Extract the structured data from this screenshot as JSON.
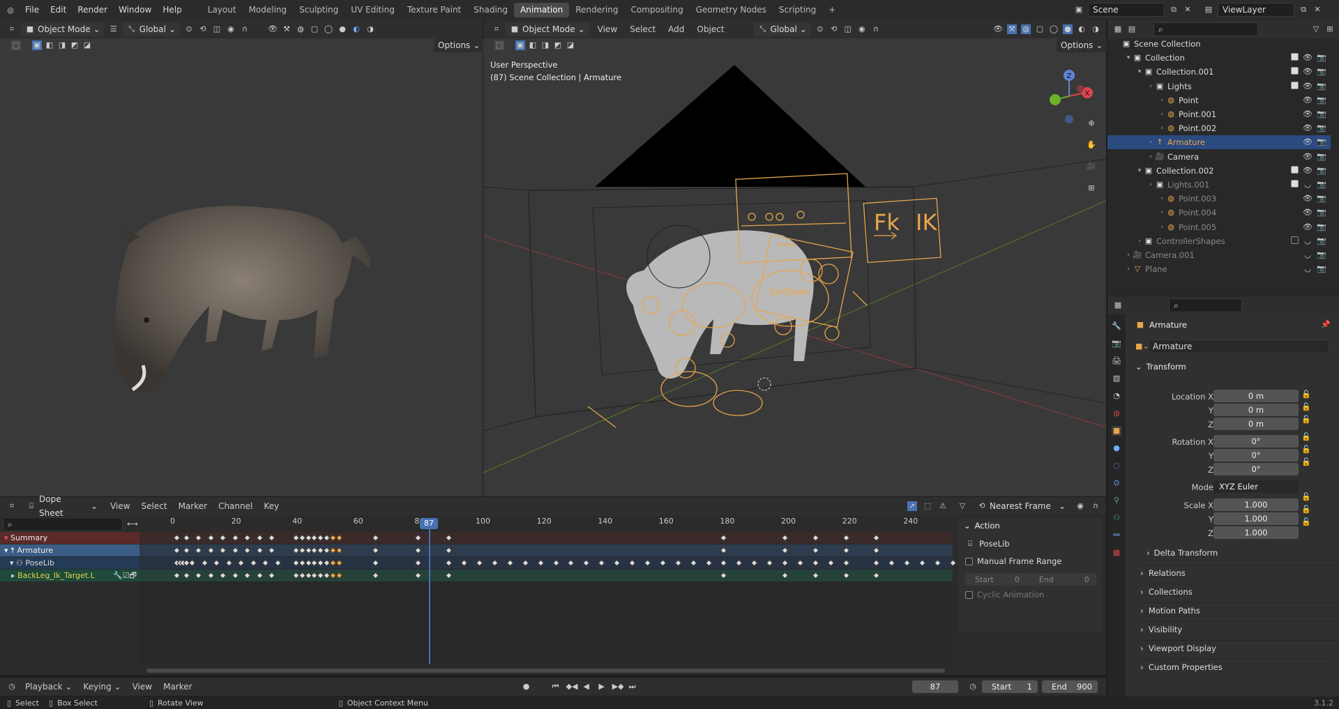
{
  "app": {
    "version": "3.1.2"
  },
  "topbar": {
    "menus": [
      "File",
      "Edit",
      "Render",
      "Window",
      "Help"
    ],
    "workspaces": [
      "Layout",
      "Modeling",
      "Sculpting",
      "UV Editing",
      "Texture Paint",
      "Shading",
      "Animation",
      "Rendering",
      "Compositing",
      "Geometry Nodes",
      "Scripting"
    ],
    "active_workspace": "Animation",
    "add": "+",
    "scene": "Scene",
    "view_layer": "ViewLayer"
  },
  "left_viewport": {
    "mode": "Object Mode",
    "orientation": "Global",
    "options": "Options"
  },
  "main_viewport": {
    "mode": "Object Mode",
    "menus": [
      "View",
      "Select",
      "Add",
      "Object"
    ],
    "orientation": "Global",
    "options": "Options",
    "perspective": "User Perspective",
    "context": "(87) Scene Collection | Armature",
    "fk_label": "Fk",
    "ik_label": "IK",
    "board_text_1": "smile",
    "board_text_2": "EarDown",
    "gizmo": {
      "x": "X",
      "y": "Y",
      "z": "Z"
    }
  },
  "outliner": {
    "search_placeholder": "",
    "rows": [
      {
        "label": "Scene Collection",
        "depth": 0,
        "icon": "collection"
      },
      {
        "label": "Collection",
        "depth": 1,
        "icon": "collection"
      },
      {
        "label": "Collection.001",
        "depth": 2,
        "icon": "collection"
      },
      {
        "label": "Lights",
        "depth": 3,
        "icon": "collection"
      },
      {
        "label": "Point",
        "depth": 4,
        "icon": "light"
      },
      {
        "label": "Point.001",
        "depth": 4,
        "icon": "light"
      },
      {
        "label": "Point.002",
        "depth": 4,
        "icon": "light"
      },
      {
        "label": "Armature",
        "depth": 3,
        "icon": "armature",
        "selected": true
      },
      {
        "label": "Camera",
        "depth": 3,
        "icon": "camera"
      },
      {
        "label": "Collection.002",
        "depth": 2,
        "icon": "collection"
      },
      {
        "label": "Lights.001",
        "depth": 3,
        "icon": "collection",
        "dim": true
      },
      {
        "label": "Point.003",
        "depth": 4,
        "icon": "light",
        "dim": true
      },
      {
        "label": "Point.004",
        "depth": 4,
        "icon": "light",
        "dim": true
      },
      {
        "label": "Point.005",
        "depth": 4,
        "icon": "light",
        "dim": true
      },
      {
        "label": "ControllerShapes",
        "depth": 2,
        "icon": "collection",
        "dim": true
      },
      {
        "label": "Camera.001",
        "depth": 1,
        "icon": "camera",
        "dim": true
      },
      {
        "label": "Plane",
        "depth": 1,
        "icon": "mesh",
        "dim": true
      }
    ]
  },
  "properties": {
    "title": "Armature",
    "object_name": "Armature",
    "transform": "Transform",
    "location_label": "Location X",
    "rotation_label": "Rotation X",
    "scale_label": "Scale X",
    "y": "Y",
    "z": "Z",
    "location": [
      "0 m",
      "0 m",
      "0 m"
    ],
    "rotation": [
      "0°",
      "0°",
      "0°"
    ],
    "mode_label": "Mode",
    "mode_value": "XYZ Euler",
    "scale": [
      "1.000",
      "1.000",
      "1.000"
    ],
    "delta": "Delta Transform",
    "sections": [
      "Relations",
      "Collections",
      "Motion Paths",
      "Visibility",
      "Viewport Display",
      "Custom Properties"
    ]
  },
  "dopesheet": {
    "mode": "Dope Sheet",
    "menus": [
      "View",
      "Select",
      "Marker",
      "Channel",
      "Key"
    ],
    "snap": "Nearest Frame",
    "current_frame": "87",
    "ticks": [
      "0",
      "20",
      "40",
      "60",
      "80",
      "100",
      "120",
      "140",
      "160",
      "180",
      "200",
      "220",
      "240"
    ],
    "channels": [
      "Summary",
      "Armature",
      "PoseLib",
      "BackLeg_Ik_Target.L"
    ],
    "action": {
      "title": "Action",
      "name": "PoseLib",
      "manual_range": "Manual Frame Range",
      "start_label": "Start",
      "start_val": "0",
      "end_label": "End",
      "end_val": "0",
      "cyclic": "Cyclic Animation"
    }
  },
  "timeline": {
    "menus": [
      "Playback",
      "Keying",
      "View",
      "Marker"
    ],
    "current_frame": "87",
    "start_label": "Start",
    "start": "1",
    "end_label": "End",
    "end": "900"
  },
  "statusbar": {
    "select": "Select",
    "box_select": "Box Select",
    "rotate": "Rotate View",
    "context_menu": "Object Context Menu"
  },
  "colors": {
    "accent": "#4772b3",
    "selection": "#e8a64b",
    "summary_bg": "#5b2a2a",
    "armature_bg": "#24476e",
    "poselib_bg": "#243b56",
    "channel_bg": "#1d4a3a"
  }
}
